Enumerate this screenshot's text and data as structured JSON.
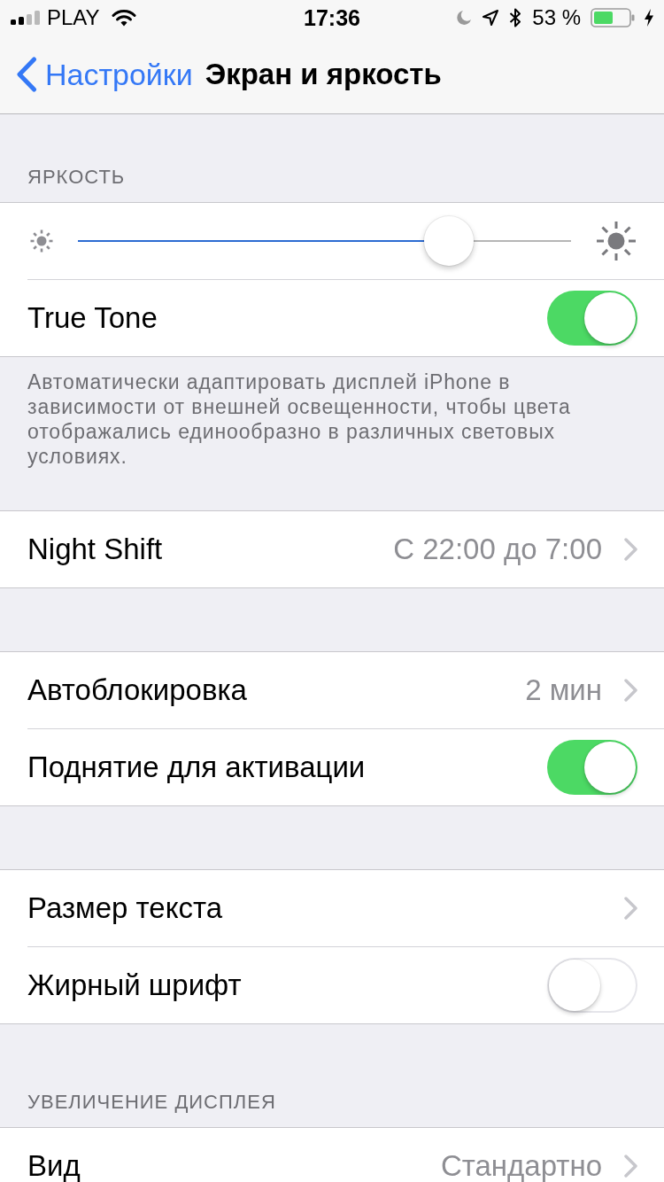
{
  "status_bar": {
    "carrier": "PLAY",
    "time": "17:36",
    "battery_percent": "53 %"
  },
  "nav_bar": {
    "back_label": "Настройки",
    "title": "Экран и яркость"
  },
  "sections": [
    {
      "header": "ЯРКОСТЬ",
      "rows": [
        {
          "kind": "slider",
          "level": 0.78
        },
        {
          "kind": "toggle",
          "label": "True Tone",
          "on": true
        }
      ],
      "footer": "Автоматически адаптировать дисплей iPhone в зависимости от внешней освещенности, чтобы цвета отображались единообразно в различных световых условиях."
    },
    {
      "rows": [
        {
          "kind": "link",
          "label": "Night Shift",
          "value": "С 22:00 до 7:00"
        }
      ]
    },
    {
      "rows": [
        {
          "kind": "link",
          "label": "Автоблокировка",
          "value": "2 мин"
        },
        {
          "kind": "toggle",
          "label": "Поднятие для активации",
          "on": true
        }
      ]
    },
    {
      "rows": [
        {
          "kind": "link",
          "label": "Размер текста"
        },
        {
          "kind": "toggle",
          "label": "Жирный шрифт",
          "on": false
        }
      ]
    },
    {
      "header": "УВЕЛИЧЕНИЕ ДИСПЛЕЯ",
      "rows": [
        {
          "kind": "link",
          "label": "Вид",
          "value": "Стандартно"
        }
      ]
    }
  ]
}
